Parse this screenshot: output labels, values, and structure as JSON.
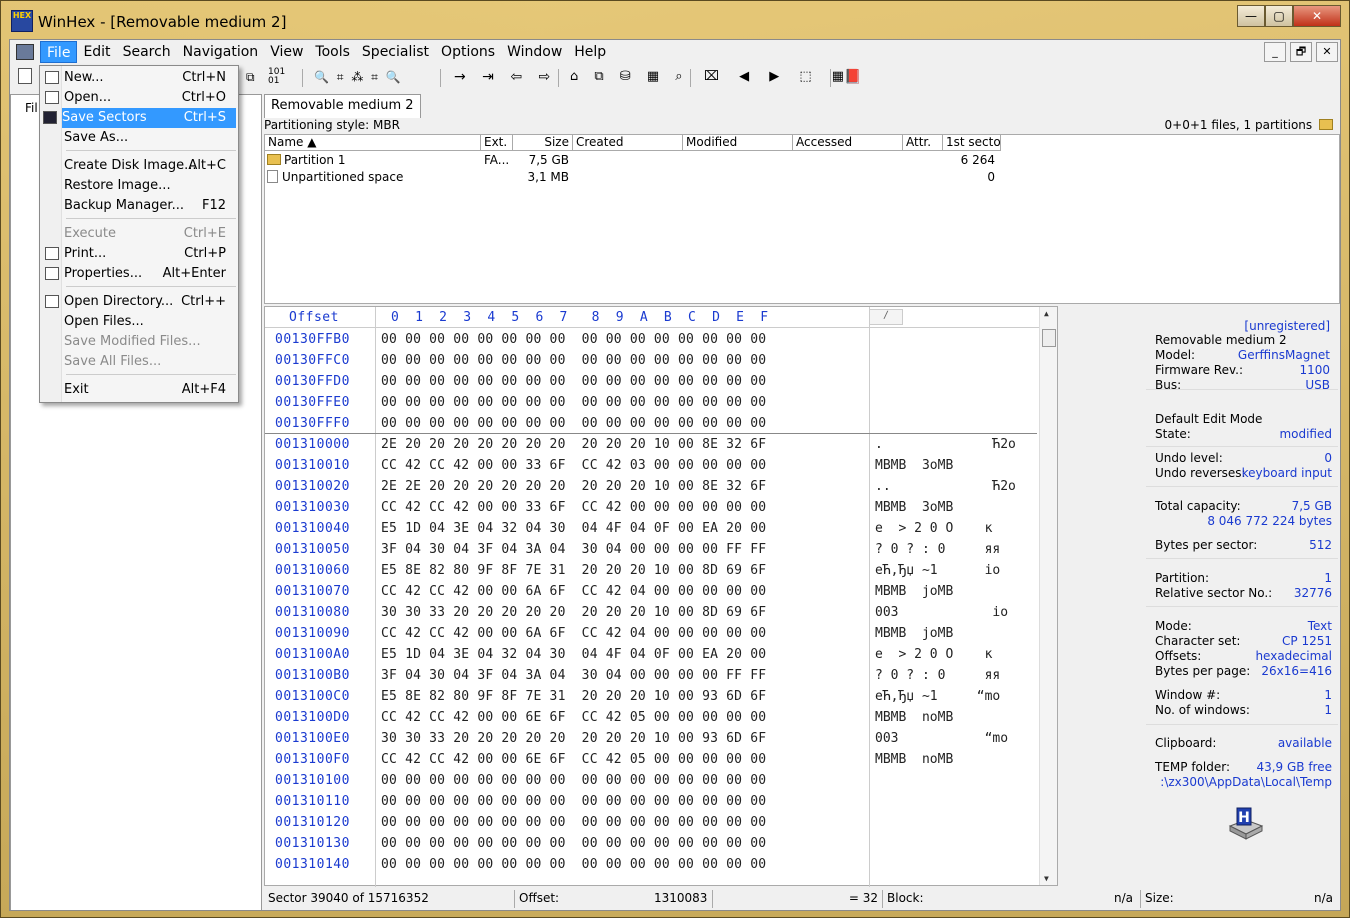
{
  "window": {
    "title": "WinHex - [Removable medium 2]",
    "logo": "HEX",
    "minimize": "—",
    "maximize": "▢",
    "close": "✕"
  },
  "menu": [
    "File",
    "Edit",
    "Search",
    "Navigation",
    "View",
    "Tools",
    "Specialist",
    "Options",
    "Window",
    "Help"
  ],
  "mdi_buttons": {
    "min": "_",
    "restore": "🗗",
    "close": "✕"
  },
  "toolbar": {
    "g1": "⧉",
    "g2": "10101",
    "g3": "🔍 ⌗ ⁂ ⌗ 🔍",
    "g4": "→ ⇥ ⇦ ⇨",
    "g5": "⌂ ⧉ ⛁ ▦ ⌕",
    "g6": "⌧ ◀ ▶ ⬚ ▦",
    "g7": "📕"
  },
  "left_pane": {
    "label": "Fil"
  },
  "tab": "Removable medium 2",
  "partition_info": {
    "style": "Partitioning style: MBR",
    "summary": "0+0+1 files, 1 partitions"
  },
  "ptable": {
    "headers": [
      "Name ▲",
      "Ext.",
      "Size",
      "Created",
      "Modified",
      "Accessed",
      "Attr.",
      "1st sector"
    ],
    "rows": [
      {
        "name": "Partition 1",
        "ext": "FA...",
        "size": "7,5 GB",
        "created": "",
        "modified": "",
        "accessed": "",
        "attr": "",
        "first": "6 264"
      },
      {
        "name": "Unpartitioned space",
        "ext": "",
        "size": "3,1 MB",
        "created": "",
        "modified": "",
        "accessed": "",
        "attr": "",
        "first": "0"
      }
    ]
  },
  "hex": {
    "header": {
      "offset": "Offset",
      "cols": "0  1  2  3  4  5  6  7   8  9  A  B  C  D  E  F",
      "marker": "∕"
    },
    "rows": [
      {
        "off": "00130FFB0",
        "hex": "00 00 00 00 00 00 00 00  00 00 00 00 00 00 00 00",
        "txt": ""
      },
      {
        "off": "00130FFC0",
        "hex": "00 00 00 00 00 00 00 00  00 00 00 00 00 00 00 00",
        "txt": ""
      },
      {
        "off": "00130FFD0",
        "hex": "00 00 00 00 00 00 00 00  00 00 00 00 00 00 00 00",
        "txt": ""
      },
      {
        "off": "00130FFE0",
        "hex": "00 00 00 00 00 00 00 00  00 00 00 00 00 00 00 00",
        "txt": ""
      },
      {
        "off": "00130FFF0",
        "hex": "00 00 00 00 00 00 00 00  00 00 00 00 00 00 00 00",
        "txt": ""
      },
      {
        "off": "001310000",
        "hex": "2E 20 20 20 20 20 20 20  20 20 20 10 00 8E 32 6F",
        "txt": ".              Ћ2o"
      },
      {
        "off": "001310010",
        "hex": "CC 42 CC 42 00 00 33 6F  CC 42 03 00 00 00 00 00",
        "txt": "MBMB  3oMB"
      },
      {
        "off": "001310020",
        "hex": "2E 2E 20 20 20 20 20 20  20 20 20 10 00 8E 32 6F",
        "txt": "..             Ћ2o"
      },
      {
        "off": "001310030",
        "hex": "CC 42 CC 42 00 00 33 6F  CC 42 00 00 00 00 00 00",
        "txt": "MBMB  3oMB"
      },
      {
        "off": "001310040",
        "hex": "E5 1D 04 3E 04 32 04 30  04 4F 04 0F 00 EA 20 00",
        "txt": "e  > 2 0 О    к"
      },
      {
        "off": "001310050",
        "hex": "3F 04 30 04 3F 04 3A 04  30 04 00 00 00 00 FF FF",
        "txt": "? 0 ? : 0     яя"
      },
      {
        "off": "001310060",
        "hex": "E5 8E 82 80 9F 8F 7E 31  20 20 20 10 00 8D 69 6F",
        "txt": "eЋ‚Ђџ ~1      io"
      },
      {
        "off": "001310070",
        "hex": "CC 42 CC 42 00 00 6A 6F  CC 42 04 00 00 00 00 00",
        "txt": "MBMB  joMB"
      },
      {
        "off": "001310080",
        "hex": "30 30 33 20 20 20 20 20  20 20 20 10 00 8D 69 6F",
        "txt": "003            io"
      },
      {
        "off": "001310090",
        "hex": "CC 42 CC 42 00 00 6A 6F  CC 42 04 00 00 00 00 00",
        "txt": "MBMB  joMB"
      },
      {
        "off": "0013100A0",
        "hex": "E5 1D 04 3E 04 32 04 30  04 4F 04 0F 00 EA 20 00",
        "txt": "e  > 2 0 О    к"
      },
      {
        "off": "0013100B0",
        "hex": "3F 04 30 04 3F 04 3A 04  30 04 00 00 00 00 FF FF",
        "txt": "? 0 ? : 0     яя"
      },
      {
        "off": "0013100C0",
        "hex": "E5 8E 82 80 9F 8F 7E 31  20 20 20 10 00 93 6D 6F",
        "txt": "eЋ‚Ђџ ~1     “mo"
      },
      {
        "off": "0013100D0",
        "hex": "CC 42 CC 42 00 00 6E 6F  CC 42 05 00 00 00 00 00",
        "txt": "MBMB  noMB"
      },
      {
        "off": "0013100E0",
        "hex": "30 30 33 20 20 20 20 20  20 20 20 10 00 93 6D 6F",
        "txt": "003           “mo"
      },
      {
        "off": "0013100F0",
        "hex": "CC 42 CC 42 00 00 6E 6F  CC 42 05 00 00 00 00 00",
        "txt": "MBMB  noMB"
      },
      {
        "off": "001310100",
        "hex": "00 00 00 00 00 00 00 00  00 00 00 00 00 00 00 00",
        "txt": ""
      },
      {
        "off": "001310110",
        "hex": "00 00 00 00 00 00 00 00  00 00 00 00 00 00 00 00",
        "txt": ""
      },
      {
        "off": "001310120",
        "hex": "00 00 00 00 00 00 00 00  00 00 00 00 00 00 00 00",
        "txt": ""
      },
      {
        "off": "001310130",
        "hex": "00 00 00 00 00 00 00 00  00 00 00 00 00 00 00 00",
        "txt": ""
      },
      {
        "off": "001310140",
        "hex": "00 00 00 00 00 00 00 00  00 00 00 00 00 00 00 00",
        "txt": ""
      }
    ]
  },
  "info": {
    "unregistered": "[unregistered]",
    "device": "Removable medium 2",
    "model_l": "Model:",
    "model_v": "GerffinsMagnet",
    "fw_l": "Firmware Rev.:",
    "fw_v": "1100",
    "bus_l": "Bus:",
    "bus_v": "USB",
    "editmode": "Default Edit Mode",
    "state_l": "State:",
    "state_v": "modified",
    "undo_l": "Undo level:",
    "undo_v": "0",
    "undorev_l": "Undo reverses:",
    "undorev_v": "keyboard input",
    "cap_l": "Total capacity:",
    "cap_v": "7,5 GB",
    "cap_bytes": "8 046 772 224 bytes",
    "bps_l": "Bytes per sector:",
    "bps_v": "512",
    "part_l": "Partition:",
    "part_v": "1",
    "rel_l": "Relative sector No.:",
    "rel_v": "32776",
    "mode_l": "Mode:",
    "mode_v": "Text",
    "cs_l": "Character set:",
    "cs_v": "CP 1251",
    "offs_l": "Offsets:",
    "offs_v": "hexadecimal",
    "bpp_l": "Bytes per page:",
    "bpp_v": "26x16=416",
    "win_l": "Window #:",
    "win_v": "1",
    "nwin_l": "No. of windows:",
    "nwin_v": "1",
    "clip_l": "Clipboard:",
    "clip_v": "available",
    "temp_l": "TEMP folder:",
    "temp_v": "43,9 GB free",
    "temp_path": ":\\zx300\\AppData\\Local\\Temp"
  },
  "status": {
    "sector": "Sector 39040 of 15716352",
    "offset_l": "Offset:",
    "offset_v": "1310083",
    "eq": "= 32",
    "block_l": "Block:",
    "block_v": "n/a",
    "size_l": "Size:",
    "size_v": "n/a"
  },
  "file_menu": [
    {
      "label": "New...",
      "key": "Ctrl+N",
      "dis": false
    },
    {
      "label": "Open...",
      "key": "Ctrl+O",
      "dis": false
    },
    {
      "label": "Save Sectors",
      "key": "Ctrl+S",
      "dis": false,
      "hl": true
    },
    {
      "label": "Save As...",
      "key": "",
      "dis": false
    },
    {
      "label": "Create Disk Image...",
      "key": "Alt+C",
      "dis": false
    },
    {
      "label": "Restore Image...",
      "key": "",
      "dis": false
    },
    {
      "label": "Backup Manager...",
      "key": "F12",
      "dis": false
    },
    {
      "label": "Execute",
      "key": "Ctrl+E",
      "dis": true
    },
    {
      "label": "Print...",
      "key": "Ctrl+P",
      "dis": false
    },
    {
      "label": "Properties...",
      "key": "Alt+Enter",
      "dis": false
    },
    {
      "label": "Open Directory...",
      "key": "Ctrl++",
      "dis": false
    },
    {
      "label": "Open Files...",
      "key": "",
      "dis": false
    },
    {
      "label": "Save Modified Files...",
      "key": "",
      "dis": true
    },
    {
      "label": "Save All Files...",
      "key": "",
      "dis": true
    },
    {
      "label": "Exit",
      "key": "Alt+F4",
      "dis": false
    }
  ]
}
